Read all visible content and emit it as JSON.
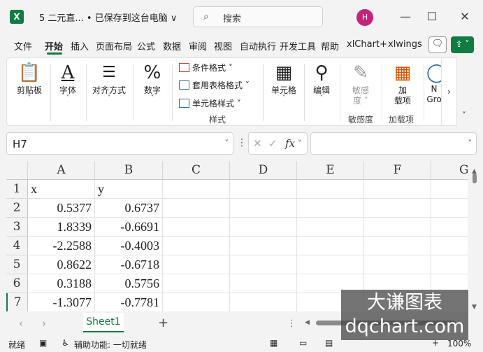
{
  "titlebar": {
    "app_icon": "X",
    "doc_title": "5 二元直... • 已保存到这台电脑 ∨",
    "search_placeholder": "搜索",
    "avatar_initial": "H"
  },
  "tabs": [
    "文件",
    "开始",
    "插入",
    "页面布局",
    "公式",
    "数据",
    "审阅",
    "视图",
    "自动执行",
    "开发工具",
    "帮助",
    "xlChart+",
    "xlwings"
  ],
  "active_tab": "开始",
  "ribbon": {
    "paste": "剪贴板",
    "font": "字体",
    "align": "对齐方式",
    "number": "数字",
    "cond_format": "条件格式 ˅",
    "table_format": "套用表格格式 ˅",
    "cell_style": "单元格样式 ˅",
    "styles_group": "样式",
    "cells": "单元格",
    "edit": "编辑",
    "sensitivity_1": "敏感",
    "sensitivity_2": "度 ˅",
    "sensitivity_group": "敏感度",
    "addins_1": "加",
    "addins_2": "载项",
    "addins_group": "加载项",
    "partial_1": "N",
    "partial_2": "Gro"
  },
  "formula_bar": {
    "name_box": "H7",
    "fx": "fx",
    "content": ""
  },
  "grid": {
    "columns": [
      "A",
      "B",
      "C",
      "D",
      "E",
      "F",
      "G"
    ],
    "rows": [
      "1",
      "2",
      "3",
      "4",
      "5",
      "6",
      "7"
    ],
    "cells": [
      [
        "x",
        "y"
      ],
      [
        "0.5377",
        "0.6737"
      ],
      [
        "1.8339",
        "-0.6691"
      ],
      [
        "-2.2588",
        "-0.4003"
      ],
      [
        "0.8622",
        "-0.6718"
      ],
      [
        "0.3188",
        "0.5756"
      ],
      [
        "-1.3077",
        "-0.7781"
      ]
    ]
  },
  "sheet": {
    "tab_name": "Sheet1",
    "add": "+"
  },
  "status": {
    "ready": "就绪",
    "accessibility": "辅助功能: 一切就绪",
    "zoom": "100%"
  },
  "watermark": {
    "line1": "大谦图表",
    "line2": "dqchart.com"
  },
  "colors": {
    "accent": "#107c41",
    "avatar": "#c3247a"
  }
}
